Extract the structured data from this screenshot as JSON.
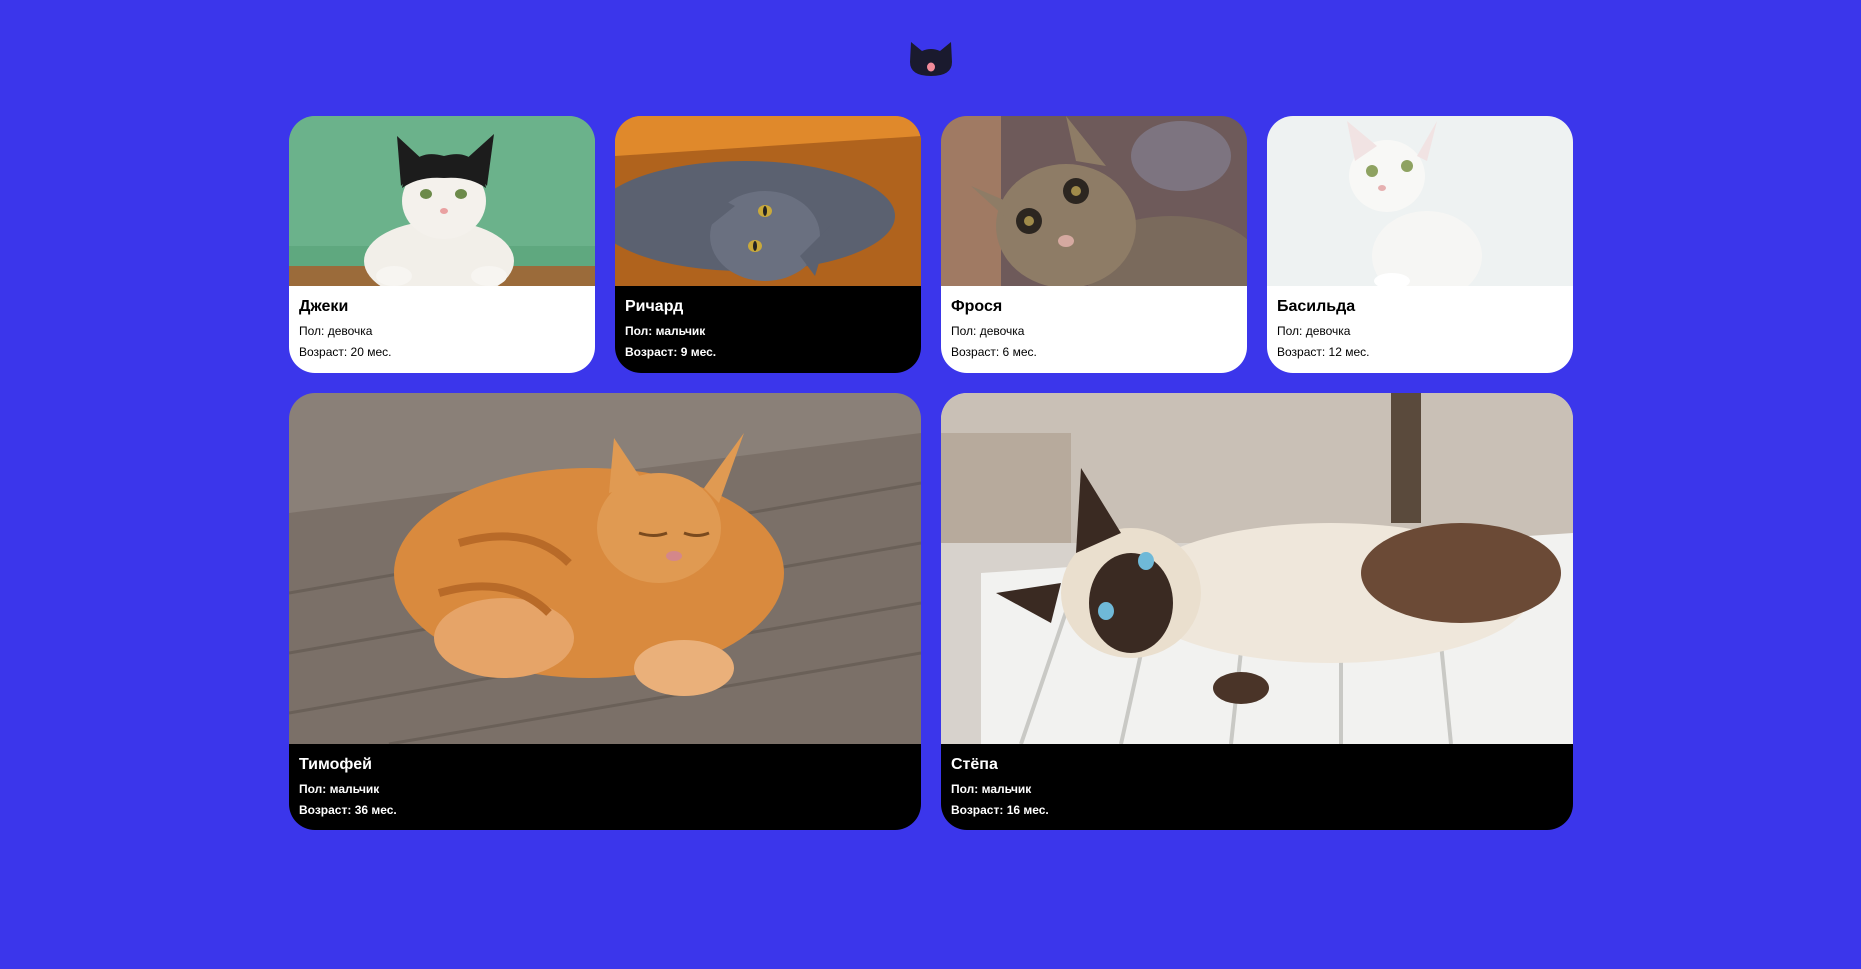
{
  "header": {
    "logo_icon": "cat-head-icon"
  },
  "labels": {
    "sex_prefix": "Пол:",
    "age_prefix": "Возраст:"
  },
  "cats": [
    {
      "name": "Джеки",
      "sex_line": "Пол: девочка",
      "age_line": "Возраст: 20 мес.",
      "theme": "light"
    },
    {
      "name": "Ричард",
      "sex_line": "Пол: мальчик",
      "age_line": "Возраст: 9 мес.",
      "theme": "dark"
    },
    {
      "name": "Фрося",
      "sex_line": "Пол: девочка",
      "age_line": "Возраст: 6 мес.",
      "theme": "light"
    },
    {
      "name": "Басильда",
      "sex_line": "Пол: девочка",
      "age_line": "Возраст: 12 мес.",
      "theme": "light"
    },
    {
      "name": "Тимофей",
      "sex_line": "Пол: мальчик",
      "age_line": "Возраст: 36 мес.",
      "theme": "dark"
    },
    {
      "name": "Стёпа",
      "sex_line": "Пол: мальчик",
      "age_line": "Возраст: 16 мес.",
      "theme": "dark"
    }
  ],
  "colors": {
    "page_background": "#3b36eb",
    "card_light": "#ffffff",
    "card_dark": "#000000",
    "logo": "#1a1a2e",
    "logo_tongue": "#f28b9b"
  }
}
